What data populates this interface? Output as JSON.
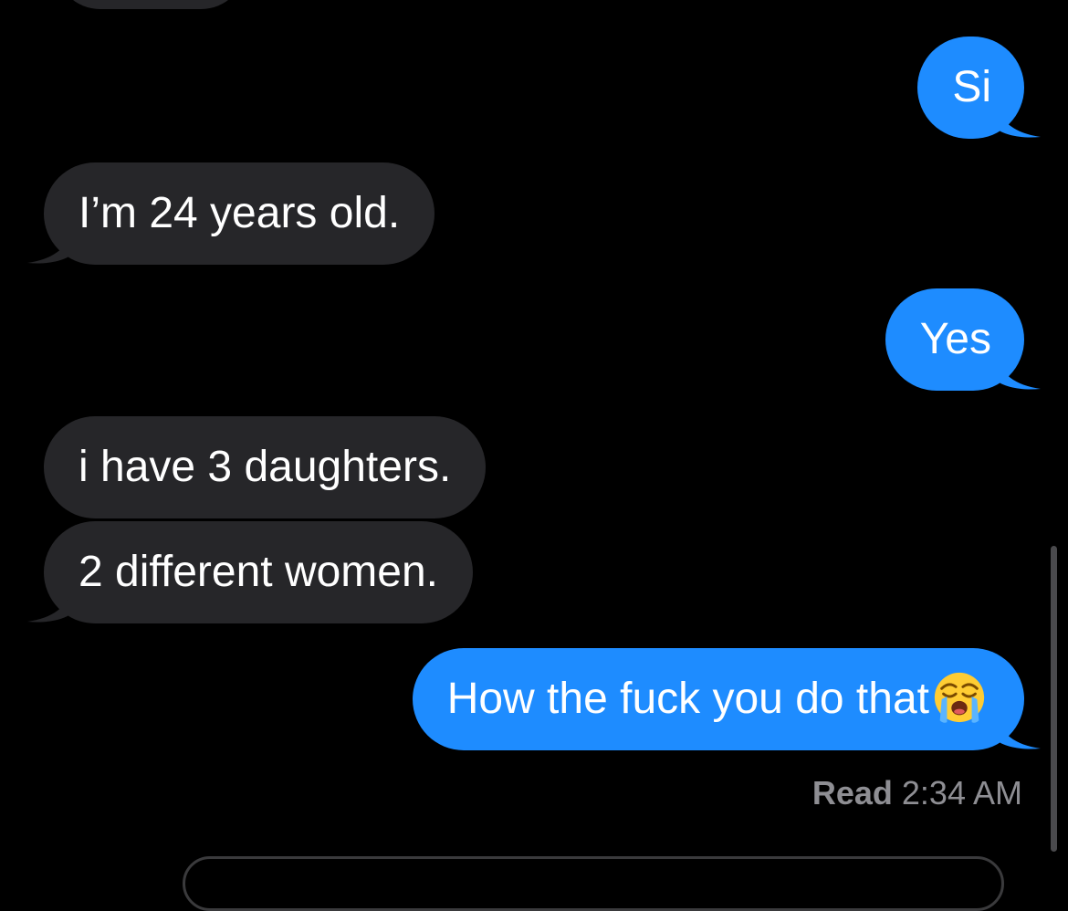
{
  "conversation": {
    "messages": [
      {
        "sender": "me",
        "text": "Si"
      },
      {
        "sender": "them",
        "text": "I’m 24 years old."
      },
      {
        "sender": "me",
        "text": "Yes"
      },
      {
        "sender": "them",
        "text": "i have 3 daughters."
      },
      {
        "sender": "them",
        "text": "2 different women."
      },
      {
        "sender": "me",
        "text": "How the fuck you do that",
        "emoji": "loudly-crying-face"
      }
    ],
    "read_receipt": {
      "label": "Read",
      "time": "2:34 AM"
    }
  },
  "colors": {
    "background": "#000000",
    "sent_bubble": "#1e8cff",
    "received_bubble": "#262629",
    "receipt_text": "#8e8e93"
  }
}
